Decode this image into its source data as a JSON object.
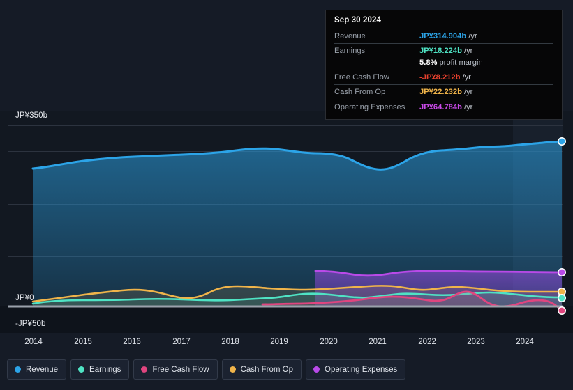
{
  "colors": {
    "revenue": "#2ca4e8",
    "earnings": "#4fe3c4",
    "free_cash_flow": "#e0457f",
    "cash_from_op": "#f0b44a",
    "operating_expenses": "#b94ae8",
    "background": "#151b26",
    "plot_background": "#121821",
    "gridline": "#2c333f",
    "zero_line": "#9aa1ab",
    "tooltip_background": "#060607",
    "tooltip_border": "#2a2d33"
  },
  "tooltip": {
    "date": "Sep 30 2024",
    "rows": [
      {
        "label": "Revenue",
        "value": "JP¥314.904b",
        "unit": "/yr",
        "color": "#2ca4e8"
      },
      {
        "label": "Earnings",
        "value": "JP¥18.224b",
        "unit": "/yr",
        "color": "#4fe3c4"
      },
      {
        "label": "",
        "margin_value": "5.8%",
        "margin_text": "profit margin"
      },
      {
        "label": "Free Cash Flow",
        "value": "-JP¥8.212b",
        "unit": "/yr",
        "color": "#e8412e"
      },
      {
        "label": "Cash From Op",
        "value": "JP¥22.232b",
        "unit": "/yr",
        "color": "#f0b44a"
      },
      {
        "label": "Operating Expenses",
        "value": "JP¥64.784b",
        "unit": "/yr",
        "color": "#c94ae8"
      }
    ]
  },
  "legend": {
    "items": [
      {
        "label": "Revenue",
        "color": "#2ca4e8"
      },
      {
        "label": "Earnings",
        "color": "#4fe3c4"
      },
      {
        "label": "Free Cash Flow",
        "color": "#e0457f"
      },
      {
        "label": "Cash From Op",
        "color": "#f0b44a"
      },
      {
        "label": "Operating Expenses",
        "color": "#b94ae8"
      }
    ]
  },
  "chart_data": {
    "type": "area",
    "title": "",
    "xlabel": "",
    "ylabel": "",
    "currency": "JP¥",
    "units": "billions",
    "ylim": [
      -50,
      350
    ],
    "ytick_labels": [
      "JP¥350b",
      "JP¥0",
      "-JP¥50b"
    ],
    "ytick_values": [
      350,
      0,
      -50
    ],
    "gridlines": [
      350,
      300,
      200,
      100
    ],
    "grid": true,
    "legend_position": "bottom-left",
    "xlim": [
      2013.7,
      2024.9
    ],
    "xtick_labels": [
      "2014",
      "2015",
      "2016",
      "2017",
      "2018",
      "2019",
      "2020",
      "2021",
      "2022",
      "2023",
      "2024"
    ],
    "xtick_values": [
      2014,
      2015,
      2016,
      2017,
      2018,
      2019,
      2020,
      2021,
      2022,
      2023,
      2024
    ],
    "highlight_band": {
      "from": 2024.1,
      "to": 2024.9,
      "label": ""
    },
    "series": [
      {
        "name": "Revenue",
        "color": "#2ca4e8",
        "x": [
          2013.75,
          2014.25,
          2014.75,
          2015.25,
          2015.75,
          2016.25,
          2016.75,
          2017.25,
          2017.75,
          2018.25,
          2018.75,
          2019.25,
          2019.75,
          2020.25,
          2020.75,
          2021.25,
          2021.75,
          2022.25,
          2022.75,
          2023.25,
          2023.75,
          2024.25,
          2024.75
        ],
        "values": [
          266,
          272,
          278,
          283,
          290,
          288,
          289,
          291,
          293,
          300,
          306,
          310,
          309,
          302,
          278,
          266,
          272,
          290,
          297,
          298,
          300,
          303,
          308,
          315
        ]
      },
      {
        "name": "Earnings",
        "color": "#4fe3c4",
        "x": [
          2013.75,
          2014.25,
          2014.75,
          2015.25,
          2015.75,
          2016.25,
          2016.75,
          2017.25,
          2017.75,
          2018.25,
          2018.75,
          2019.25,
          2019.75,
          2020.25,
          2020.75,
          2021.25,
          2021.75,
          2022.25,
          2022.75,
          2023.25,
          2023.75,
          2024.25,
          2024.75
        ],
        "values": [
          6,
          10,
          12,
          13,
          13,
          13,
          12,
          13,
          14,
          14,
          15,
          15,
          15,
          22,
          22,
          21,
          17,
          17,
          19,
          24,
          22,
          19,
          18,
          18
        ]
      },
      {
        "name": "Free Cash Flow",
        "color": "#e0457f",
        "x": [
          2019.2,
          2019.75,
          2020.25,
          2020.75,
          2021.25,
          2021.75,
          2022.25,
          2022.75,
          2023.25,
          2023.75,
          2024.25,
          2024.75
        ],
        "values": [
          4,
          3,
          3,
          3,
          4,
          6,
          7,
          16,
          4,
          2,
          9,
          4,
          -2,
          -8
        ]
      },
      {
        "name": "Cash From Op",
        "color": "#f0b44a",
        "x": [
          2013.75,
          2014.25,
          2014.75,
          2015.25,
          2015.75,
          2016.25,
          2016.75,
          2017.25,
          2017.75,
          2018.25,
          2018.75,
          2019.25,
          2019.75,
          2020.25,
          2020.75,
          2021.25,
          2021.75,
          2022.25,
          2022.75,
          2023.25,
          2023.75,
          2024.25,
          2024.75
        ],
        "values": [
          10,
          14,
          16,
          18,
          22,
          19,
          16,
          16,
          24,
          26,
          25,
          22,
          26,
          27,
          26,
          23,
          22,
          29,
          31,
          25,
          22,
          23,
          23,
          22
        ]
      },
      {
        "name": "Operating Expenses",
        "color": "#b94ae8",
        "x": [
          2019.78,
          2020.25,
          2020.75,
          2021.25,
          2021.75,
          2022.25,
          2022.75,
          2023.25,
          2023.75,
          2024.25,
          2024.75
        ],
        "values": [
          68,
          67,
          64,
          62,
          63,
          65,
          65,
          65,
          65,
          65,
          65,
          65
        ]
      }
    ]
  }
}
